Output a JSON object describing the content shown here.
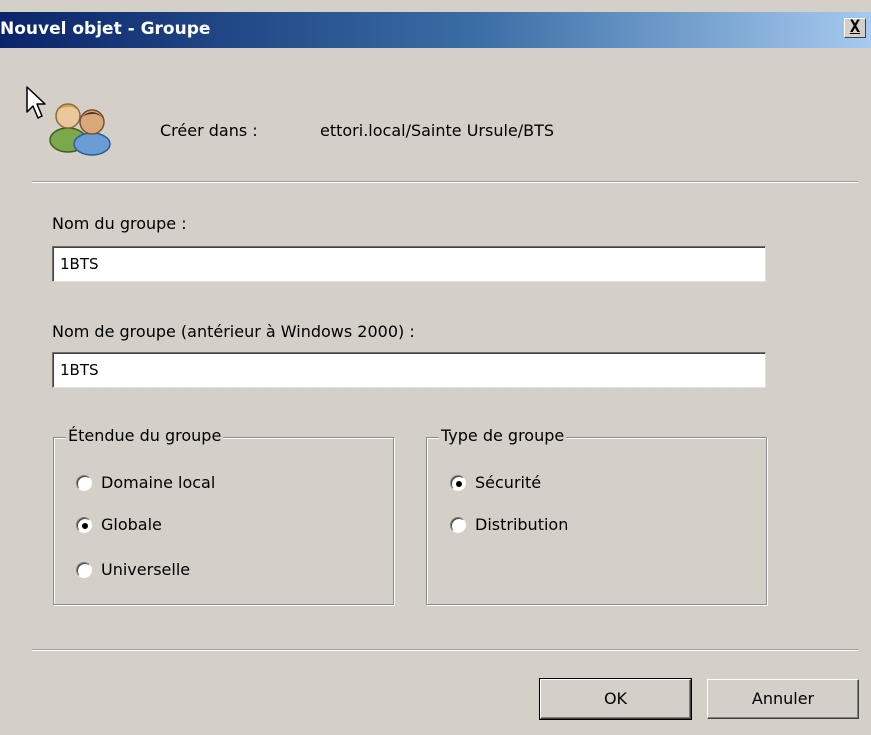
{
  "window": {
    "title": "Nouvel objet - Groupe",
    "close_glyph": "X"
  },
  "header": {
    "create_in_label": "Créer dans :",
    "create_in_path": "ettori.local/Sainte Ursule/BTS",
    "icon": "users-group-icon"
  },
  "fields": {
    "group_name_label": "Nom du groupe :",
    "group_name_value": "1BTS",
    "pre2000_label": "Nom de groupe (antérieur à Windows 2000) :",
    "pre2000_value": "1BTS"
  },
  "scope": {
    "legend": "Étendue du groupe",
    "options": [
      "Domaine local",
      "Globale",
      "Universelle"
    ],
    "selected": "Globale"
  },
  "type": {
    "legend": "Type de groupe",
    "options": [
      "Sécurité",
      "Distribution"
    ],
    "selected": "Sécurité"
  },
  "buttons": {
    "ok": "OK",
    "cancel": "Annuler"
  }
}
